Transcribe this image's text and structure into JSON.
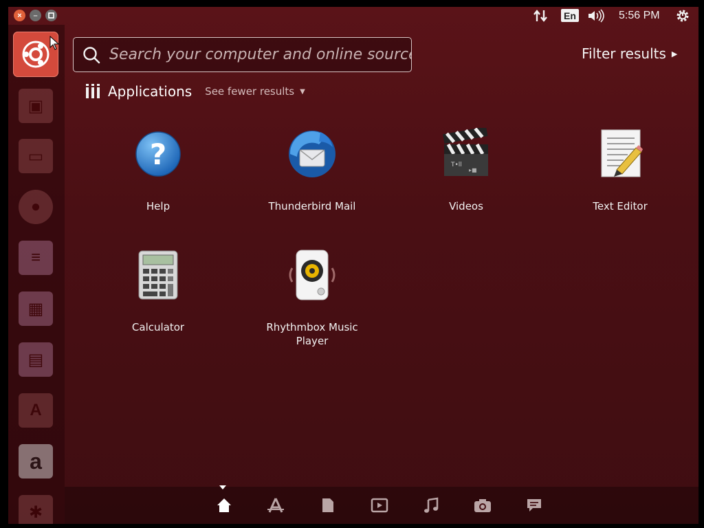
{
  "colors": {
    "background": "#4a0f14",
    "accent": "#e0613a",
    "launcher": "#280609"
  },
  "top_panel": {
    "window_buttons": [
      "close-icon",
      "minimize-icon",
      "maximize-icon"
    ],
    "language": "En",
    "clock": "5:56 PM"
  },
  "launcher": {
    "items": [
      "dash-home-icon",
      "files-icon",
      "archive-icon",
      "firefox-icon",
      "libreoffice-writer-icon",
      "libreoffice-calc-icon",
      "libreoffice-impress-icon",
      "software-center-icon",
      "amazon-icon",
      "settings-icon"
    ]
  },
  "search": {
    "placeholder": "Search your computer and online sources",
    "value": ""
  },
  "filter_results": "Filter results",
  "section": {
    "title": "Applications",
    "toggle": "See fewer results"
  },
  "apps": [
    {
      "label": "Help",
      "icon": "help-icon"
    },
    {
      "label": "Thunderbird Mail",
      "icon": "thunderbird-icon"
    },
    {
      "label": "Videos",
      "icon": "videos-icon"
    },
    {
      "label": "Text Editor",
      "icon": "text-editor-icon"
    },
    {
      "label": "Calculator",
      "icon": "calculator-icon"
    },
    {
      "label": "Rhythmbox Music Player",
      "icon": "rhythmbox-icon"
    }
  ],
  "lenses": [
    "home-lens-icon",
    "applications-lens-icon",
    "files-lens-icon",
    "video-lens-icon",
    "music-lens-icon",
    "photo-lens-icon",
    "social-lens-icon"
  ]
}
